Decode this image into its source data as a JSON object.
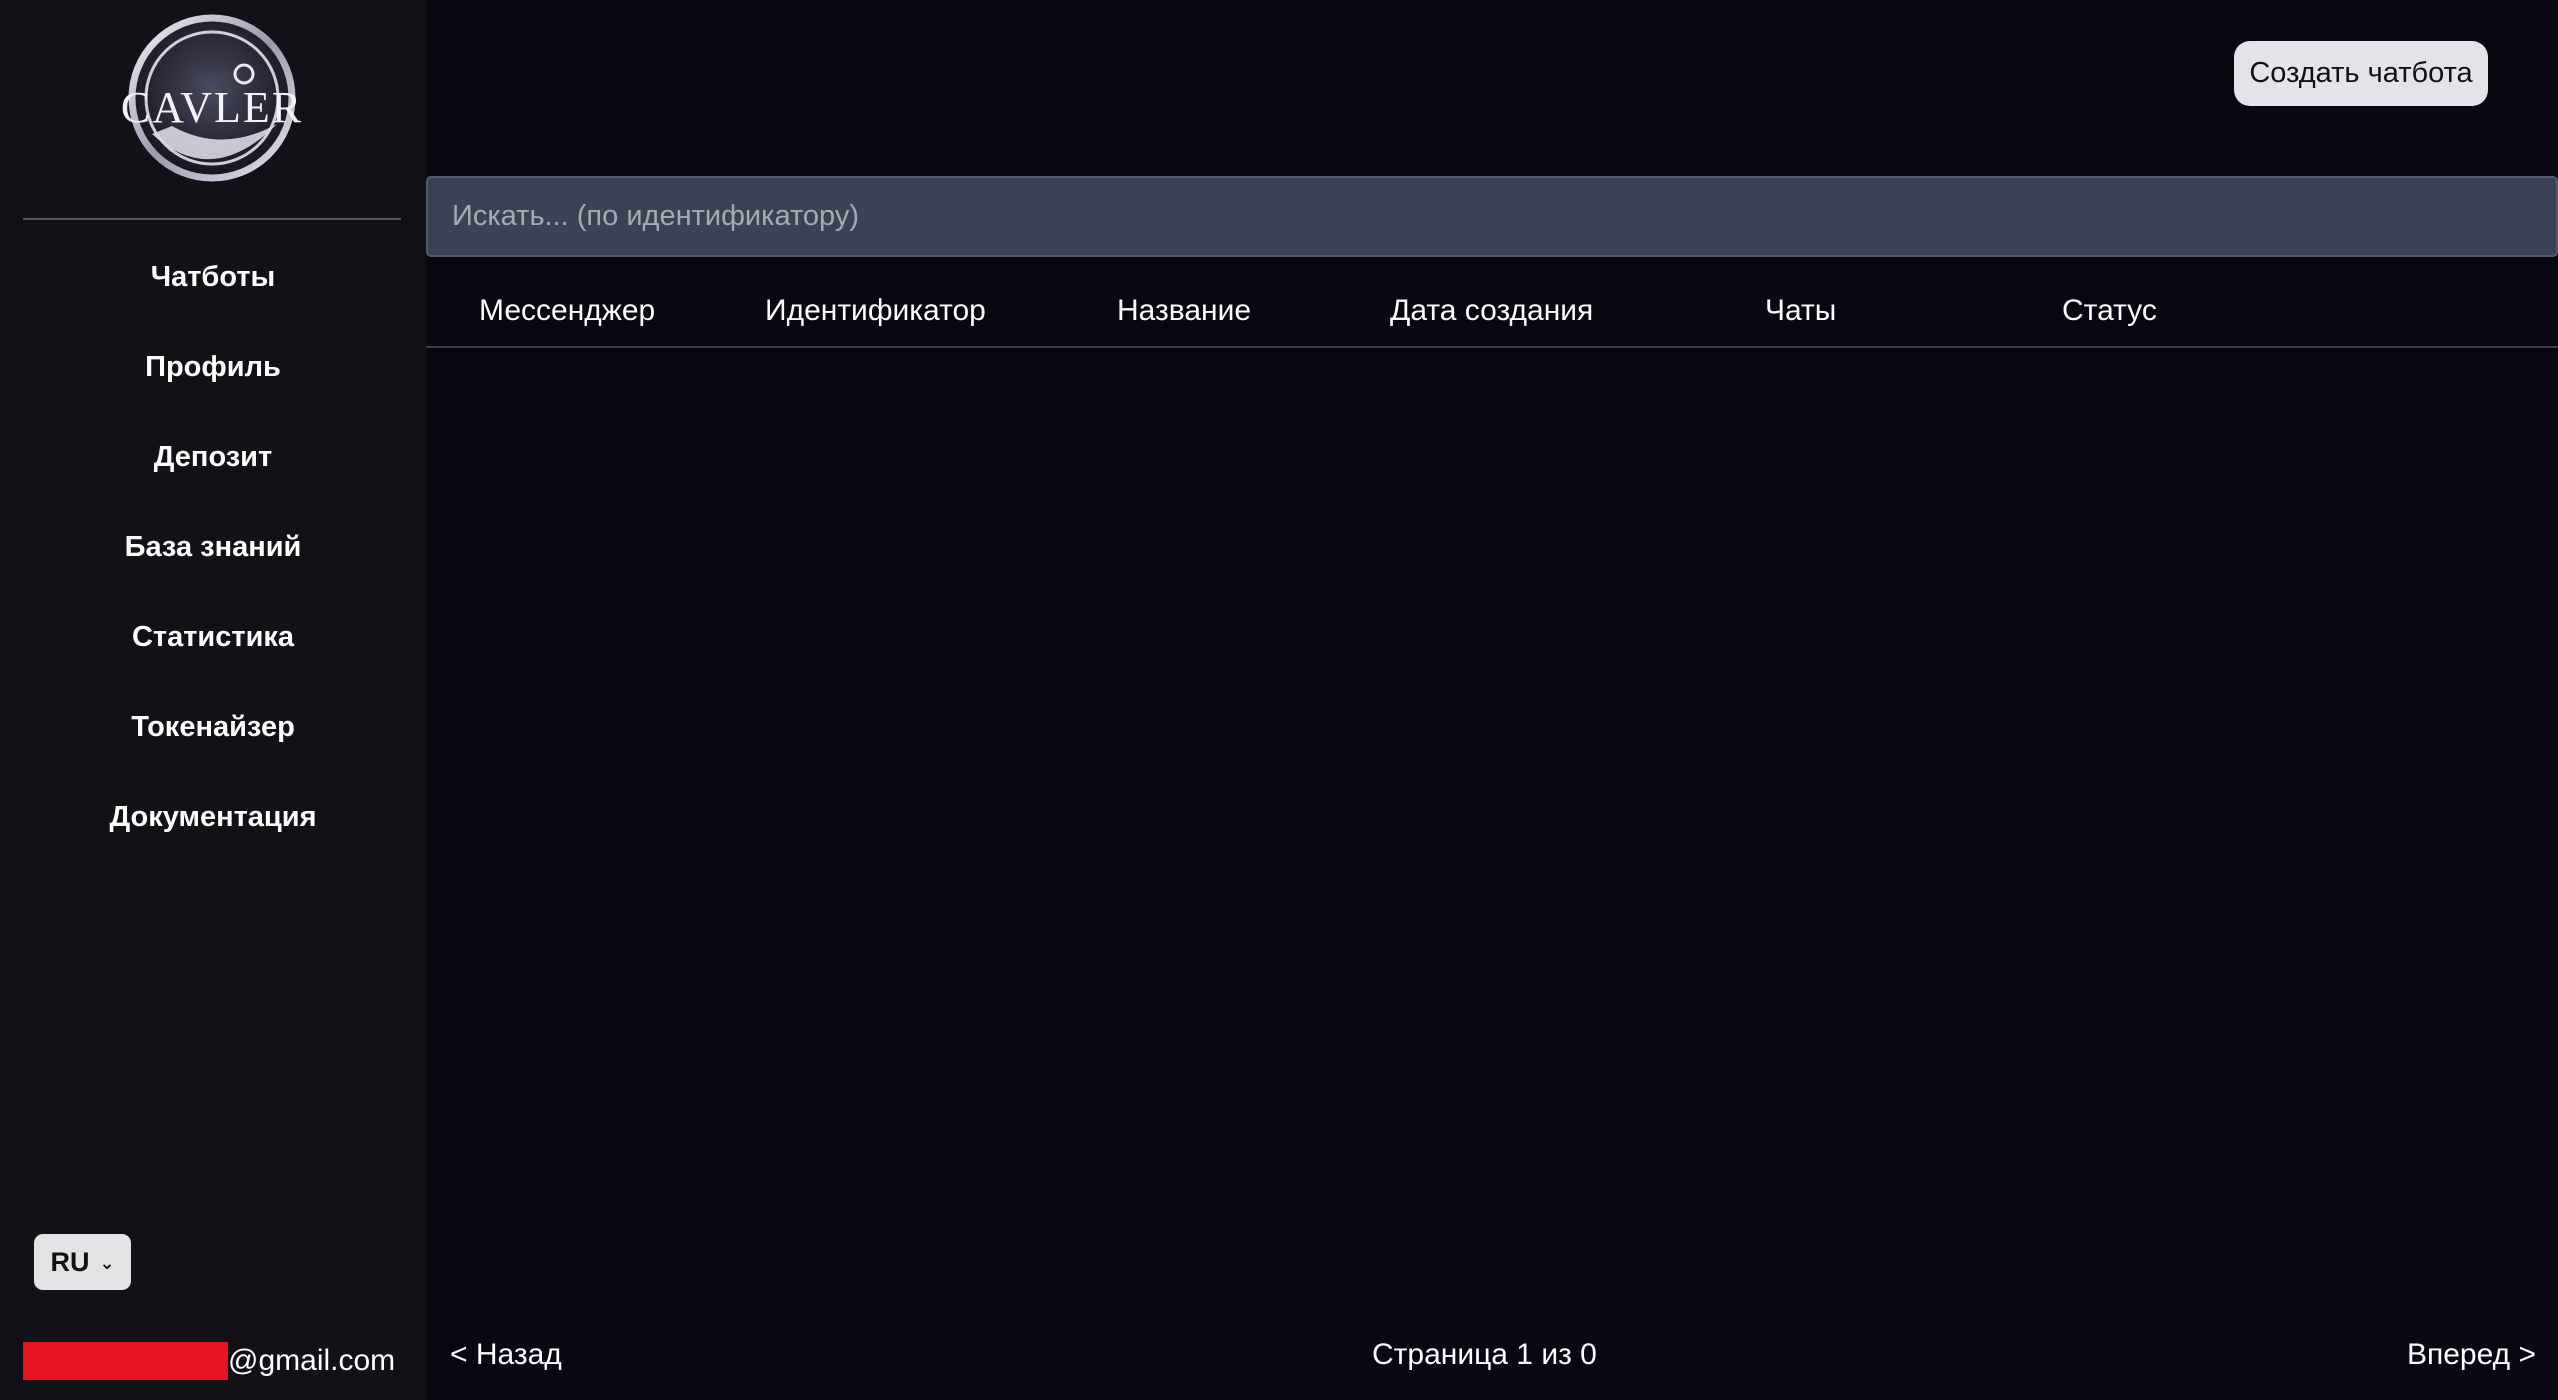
{
  "brand": {
    "name": "CAVLER"
  },
  "sidebar": {
    "items": [
      {
        "label": "Чатботы"
      },
      {
        "label": "Профиль"
      },
      {
        "label": "Депозит"
      },
      {
        "label": "База знаний"
      },
      {
        "label": "Статистика"
      },
      {
        "label": "Токенайзер"
      },
      {
        "label": "Документация"
      }
    ],
    "language": "RU",
    "user_email_suffix": "@gmail.com"
  },
  "toolbar": {
    "create_label": "Создать чатбота"
  },
  "search": {
    "placeholder": "Искать... (по идентификатору)"
  },
  "table": {
    "columns": [
      "Мессенджер",
      "Идентификатор",
      "Название",
      "Дата создания",
      "Чаты",
      "Статус"
    ],
    "rows": []
  },
  "pagination": {
    "prev_label": "< Назад",
    "info": "Страница 1 из 0",
    "next_label": "Вперед >"
  }
}
